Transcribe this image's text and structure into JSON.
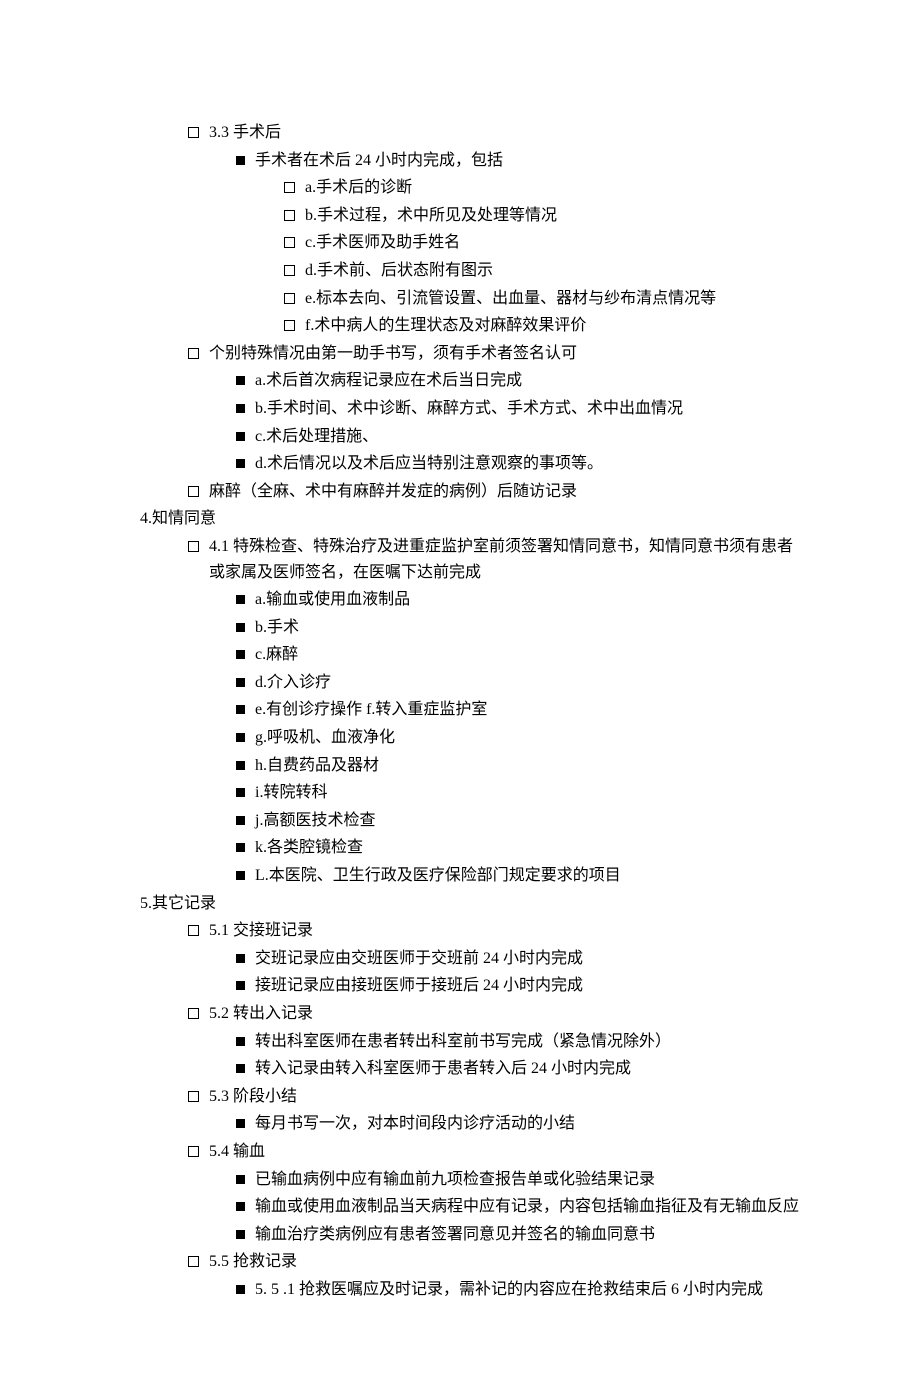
{
  "lines": [
    {
      "indent": 1,
      "bullet": "open",
      "text": "3.3 手术后"
    },
    {
      "indent": 2,
      "bullet": "filled",
      "text": "手术者在术后 24 小时内完成，包括"
    },
    {
      "indent": 3,
      "bullet": "open",
      "text": "a.手术后的诊断"
    },
    {
      "indent": 3,
      "bullet": "open",
      "text": "b.手术过程，术中所见及处理等情况"
    },
    {
      "indent": 3,
      "bullet": "open",
      "text": "c.手术医师及助手姓名"
    },
    {
      "indent": 3,
      "bullet": "open",
      "text": "d.手术前、后状态附有图示"
    },
    {
      "indent": 3,
      "bullet": "open",
      "text": "e.标本去向、引流管设置、出血量、器材与纱布清点情况等"
    },
    {
      "indent": 3,
      "bullet": "open",
      "text": "f.术中病人的生理状态及对麻醉效果评价"
    },
    {
      "indent": 1,
      "bullet": "open",
      "text": "个别特殊情况由第一助手书写，须有手术者签名认可"
    },
    {
      "indent": 2,
      "bullet": "filled",
      "text": "a.术后首次病程记录应在术后当日完成"
    },
    {
      "indent": 2,
      "bullet": "filled",
      "text": "b.手术时间、术中诊断、麻醉方式、手术方式、术中出血情况"
    },
    {
      "indent": 2,
      "bullet": "filled",
      "text": "c.术后处理措施、"
    },
    {
      "indent": 2,
      "bullet": "filled",
      "text": "d.术后情况以及术后应当特别注意观察的事项等。"
    },
    {
      "indent": 1,
      "bullet": "open",
      "text": "麻醉（全麻、术中有麻醉并发症的病例）后随访记录"
    },
    {
      "indent": 0,
      "bullet": "none",
      "text": "4.知情同意"
    },
    {
      "indent": 1,
      "bullet": "open",
      "text": "4.1 特殊检查、特殊治疗及进重症监护室前须签署知情同意书，知情同意书须有患者或家属及医师签名，在医嘱下达前完成",
      "wrap": true
    },
    {
      "indent": 2,
      "bullet": "filled",
      "text": "a.输血或使用血液制品"
    },
    {
      "indent": 2,
      "bullet": "filled",
      "text": "b.手术"
    },
    {
      "indent": 2,
      "bullet": "filled",
      "text": "c.麻醉"
    },
    {
      "indent": 2,
      "bullet": "filled",
      "text": "d.介入诊疗"
    },
    {
      "indent": 2,
      "bullet": "filled",
      "text": "e.有创诊疗操作 f.转入重症监护室"
    },
    {
      "indent": 2,
      "bullet": "filled",
      "text": "g.呼吸机、血液净化"
    },
    {
      "indent": 2,
      "bullet": "filled",
      "text": "h.自费药品及器材"
    },
    {
      "indent": 2,
      "bullet": "filled",
      "text": "i.转院转科"
    },
    {
      "indent": 2,
      "bullet": "filled",
      "text": "j.高额医技术检查"
    },
    {
      "indent": 2,
      "bullet": "filled",
      "text": "k.各类腔镜检查"
    },
    {
      "indent": 2,
      "bullet": "filled",
      "text": "L.本医院、卫生行政及医疗保险部门规定要求的项目"
    },
    {
      "indent": 0,
      "bullet": "none",
      "text": "5.其它记录"
    },
    {
      "indent": 1,
      "bullet": "open",
      "text": "5.1 交接班记录"
    },
    {
      "indent": 2,
      "bullet": "filled",
      "text": "交班记录应由交班医师于交班前 24 小时内完成"
    },
    {
      "indent": 2,
      "bullet": "filled",
      "text": "接班记录应由接班医师于接班后 24 小时内完成"
    },
    {
      "indent": 1,
      "bullet": "open",
      "text": "5.2 转出入记录"
    },
    {
      "indent": 2,
      "bullet": "filled",
      "text": "转出科室医师在患者转出科室前书写完成（紧急情况除外）"
    },
    {
      "indent": 2,
      "bullet": "filled",
      "text": "转入记录由转入科室医师于患者转入后 24 小时内完成"
    },
    {
      "indent": 1,
      "bullet": "open",
      "text": "5.3 阶段小结"
    },
    {
      "indent": 2,
      "bullet": "filled",
      "text": "每月书写一次，对本时间段内诊疗活动的小结"
    },
    {
      "indent": 1,
      "bullet": "open",
      "text": "5.4 输血"
    },
    {
      "indent": 2,
      "bullet": "filled",
      "text": "已输血病例中应有输血前九项检查报告单或化验结果记录"
    },
    {
      "indent": 2,
      "bullet": "filled",
      "text": "输血或使用血液制品当天病程中应有记录，内容包括输血指征及有无输血反应",
      "wrap": true
    },
    {
      "indent": 2,
      "bullet": "filled",
      "text": "输血治疗类病例应有患者签署同意见并签名的输血同意书"
    },
    {
      "indent": 1,
      "bullet": "open",
      "text": "5.5 抢救记录"
    },
    {
      "indent": 2,
      "bullet": "filled",
      "text": "5. 5 .1 抢救医嘱应及时记录，需补记的内容应在抢救结束后 6 小时内完成"
    }
  ]
}
